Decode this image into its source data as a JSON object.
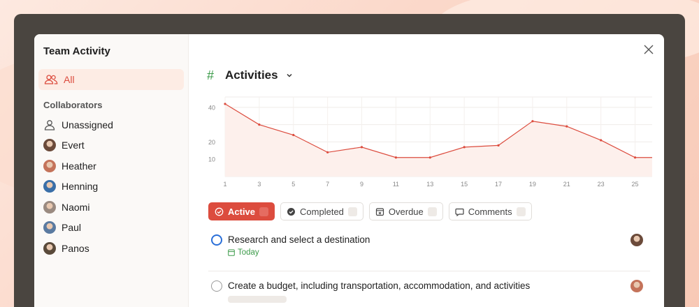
{
  "sidebar": {
    "title": "Team Activity",
    "all_label": "All",
    "section_label": "Collaborators",
    "items": [
      {
        "label": "Unassigned",
        "kind": "person-outline"
      },
      {
        "label": "Evert",
        "color": "#6b4a3a"
      },
      {
        "label": "Heather",
        "color": "#c4735a"
      },
      {
        "label": "Henning",
        "color": "#3a6fa8"
      },
      {
        "label": "Naomi",
        "color": "#9a8a80"
      },
      {
        "label": "Paul",
        "color": "#5a7aa0"
      },
      {
        "label": "Panos",
        "color": "#5a4a3a"
      }
    ]
  },
  "header": {
    "title": "Activities",
    "hash": "#"
  },
  "chart_data": {
    "type": "area",
    "x": [
      1,
      3,
      5,
      7,
      9,
      11,
      13,
      15,
      17,
      19,
      21,
      23,
      25,
      26
    ],
    "values": [
      42,
      30,
      24,
      14,
      17,
      11,
      11,
      17,
      18,
      32,
      29,
      21,
      11,
      11
    ],
    "xticks": [
      "1",
      "3",
      "5",
      "7",
      "9",
      "11",
      "13",
      "15",
      "17",
      "19",
      "21",
      "23",
      "25"
    ],
    "yticks": [
      "10",
      "20",
      "40"
    ],
    "yticks_values": [
      10,
      20,
      40
    ],
    "ylim": [
      0,
      46
    ],
    "xlim": [
      1,
      26
    ],
    "line_color": "#dc4c3e",
    "fill_color": "#fdf0ec",
    "grid": true
  },
  "filters": [
    {
      "label": "Active",
      "icon": "circle-check-icon",
      "active": true
    },
    {
      "label": "Completed",
      "icon": "check-circle-filled-icon",
      "active": false
    },
    {
      "label": "Overdue",
      "icon": "calendar-x-icon",
      "active": false
    },
    {
      "label": "Comments",
      "icon": "comment-icon",
      "active": false
    }
  ],
  "tasks": [
    {
      "text": "Research and select a destination",
      "due": "Today",
      "assignee_color": "#6b4a3a"
    },
    {
      "text": "Create a budget, including transportation, accommodation, and activities",
      "due": "",
      "assignee_color": "#c4735a"
    }
  ],
  "colors": {
    "accent": "#dc4c3e",
    "green": "#3c9b4a",
    "blue": "#2a6fd8"
  }
}
